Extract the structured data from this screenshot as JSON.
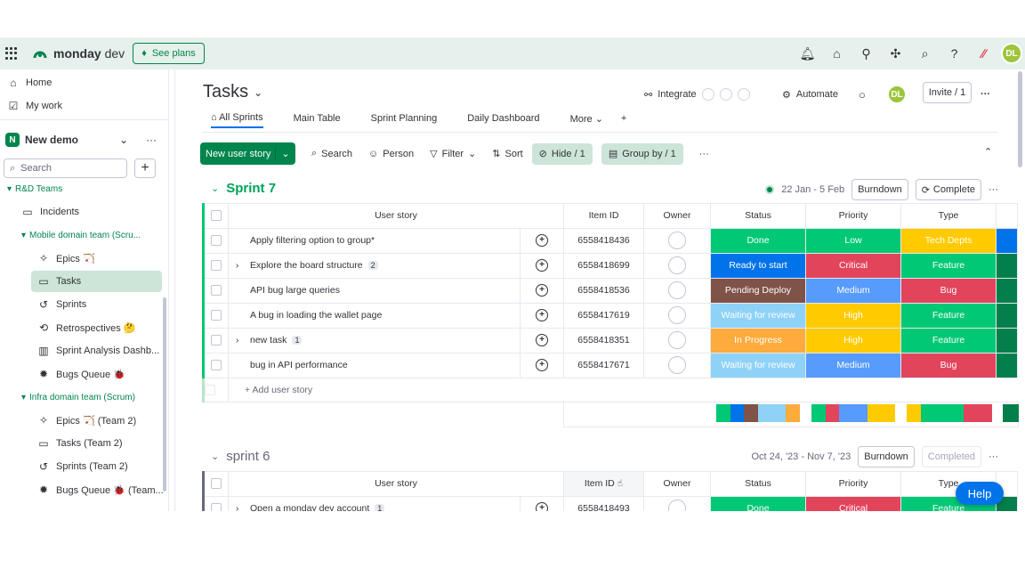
{
  "topbar": {
    "brand_bold": "monday",
    "brand_light": " dev",
    "see_plans": "See plans",
    "avatar": "DL",
    "icons": [
      "bell-icon",
      "inbox-icon",
      "invite-members-icon",
      "apps-icon",
      "search-icon",
      "help-icon",
      "monday-apps-icon"
    ]
  },
  "sidebar": {
    "home": "Home",
    "my_work": "My work",
    "workspace_badge": "N",
    "workspace": "New demo",
    "search_placeholder": "Search",
    "folder_rd": "R&D Teams",
    "incidents": "Incidents",
    "folder_mobile": "Mobile domain team (Scru...",
    "epics": "Epics 🏹",
    "tasks": "Tasks",
    "sprints": "Sprints",
    "retrospectives": "Retrospectives 🤔",
    "sprint_analysis": "Sprint Analysis Dashb...",
    "bugs_queue": "Bugs Queue 🐞",
    "folder_infra": "Infra domain team (Scrum)",
    "epics2": "Epics 🏹 (Team 2)",
    "tasks2": "Tasks (Team 2)",
    "sprints2": "Sprints (Team 2)",
    "bugs_queue2": "Bugs Queue 🐞 (Team..."
  },
  "header": {
    "title": "Tasks",
    "integrate": "Integrate",
    "automate": "Automate",
    "avatar": "DL",
    "invite": "Invite / 1"
  },
  "tabs": [
    "All Sprints",
    "Main Table",
    "Sprint Planning",
    "Daily Dashboard",
    "More"
  ],
  "toolbar": {
    "new_item": "New user story",
    "search": "Search",
    "person": "Person",
    "filter": "Filter",
    "sort": "Sort",
    "hide": "Hide / 1",
    "group_by": "Group by / 1"
  },
  "columns": {
    "story": "User story",
    "item_id": "Item ID",
    "owner": "Owner",
    "status": "Status",
    "priority": "Priority",
    "type": "Type"
  },
  "colors": {
    "green": "#00c875",
    "dark_green": "#037f4c",
    "blue": "#0073ea",
    "brown": "#7f5347",
    "light_blue": "#9aadff",
    "sky": "#66ccff",
    "orange": "#fdab3d",
    "yellow": "#ffcb00",
    "red": "#e2445c",
    "mid_blue": "#579bfc",
    "accent": "#00854d"
  },
  "sprint7": {
    "title": "Sprint 7",
    "dates": "22 Jan - 5 Feb",
    "burndown": "Burndown",
    "complete": "Complete",
    "add": "+ Add user story",
    "rows": [
      {
        "story": "Apply filtering option to group*",
        "count": "",
        "id": "6558418436",
        "status": "Done",
        "status_color": "#00c875",
        "priority": "Low",
        "priority_color": "#00c875",
        "type": "Tech Depts",
        "type_color": "#ffcb00",
        "extra_color": "#0073ea"
      },
      {
        "story": "Explore the board structure",
        "count": "2",
        "id": "6558418699",
        "status": "Ready to start",
        "status_color": "#0073ea",
        "priority": "Critical",
        "priority_color": "#e2445c",
        "type": "Feature",
        "type_color": "#00c875",
        "extra_color": "#037f4c"
      },
      {
        "story": "API bug large queries",
        "count": "",
        "id": "6558418536",
        "status": "Pending Deploy",
        "status_color": "#7f5347",
        "priority": "Medium",
        "priority_color": "#579bfc",
        "type": "Bug",
        "type_color": "#e2445c",
        "extra_color": "#037f4c"
      },
      {
        "story": "A bug in loading the wallet page",
        "count": "",
        "id": "6558417619",
        "status": "Waiting for review",
        "status_color": "#8fd2f7",
        "priority": "High",
        "priority_color": "#ffcb00",
        "type": "Feature",
        "type_color": "#00c875",
        "extra_color": "#037f4c"
      },
      {
        "story": "new task",
        "count": "1",
        "id": "6558418351",
        "status": "In Progress",
        "status_color": "#fdab3d",
        "priority": "High",
        "priority_color": "#ffcb00",
        "type": "Feature",
        "type_color": "#00c875",
        "extra_color": "#037f4c"
      },
      {
        "story": "bug in API performance",
        "count": "",
        "id": "6558417671",
        "status": "Waiting for review",
        "status_color": "#8fd2f7",
        "priority": "Medium",
        "priority_color": "#579bfc",
        "type": "Bug",
        "type_color": "#e2445c",
        "extra_color": "#037f4c"
      }
    ]
  },
  "sprint6": {
    "title": "sprint 6",
    "dates": "Oct 24, '23 - Nov 7, '23",
    "burndown": "Burndown",
    "completed": "Completed",
    "first_row": {
      "story": "Open a monday dev account",
      "count": "1",
      "id": "6558418493",
      "status": "Done",
      "priority": "Critical",
      "type": "Feature"
    }
  },
  "help": "Help"
}
